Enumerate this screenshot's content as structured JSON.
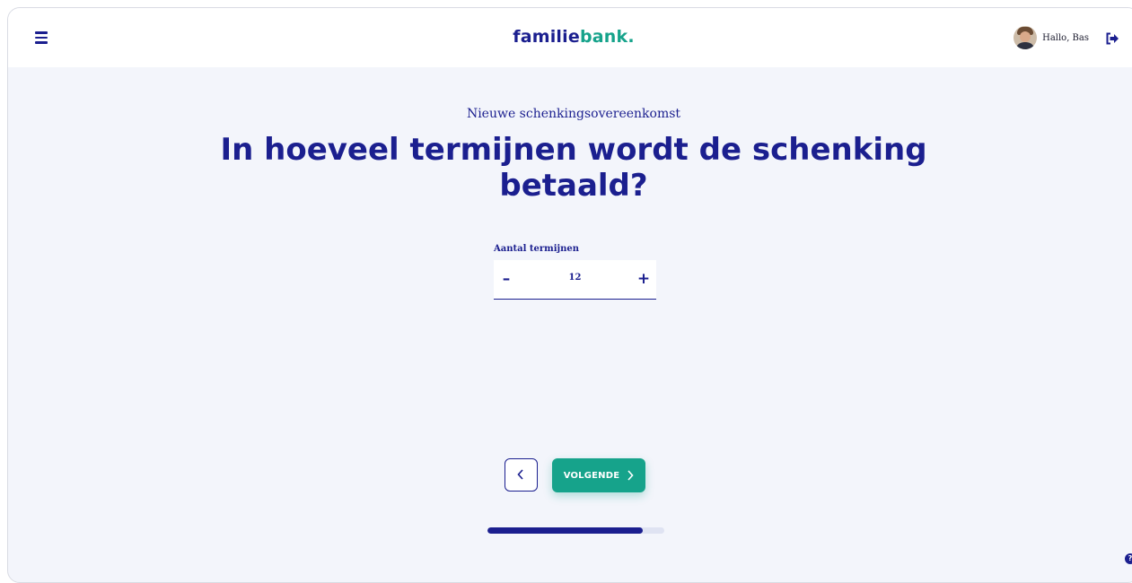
{
  "header": {
    "logo_part1": "familie",
    "logo_part2": "bank.",
    "greeting": "Hallo, Bas"
  },
  "main": {
    "subtitle": "Nieuwe schenkingsovereenkomst",
    "title": "In hoeveel termijnen wordt de schenking betaald?",
    "field_label": "Aantal termijnen",
    "stepper": {
      "minus": "–",
      "value": "12",
      "plus": "+"
    }
  },
  "nav": {
    "next_label": "VOLGENDE"
  },
  "progress": {
    "fraction": 0.88
  },
  "help": {
    "icon": "?"
  },
  "colors": {
    "primary": "#1b1f8f",
    "accent": "#16a38b",
    "background": "#f3f5fb"
  }
}
